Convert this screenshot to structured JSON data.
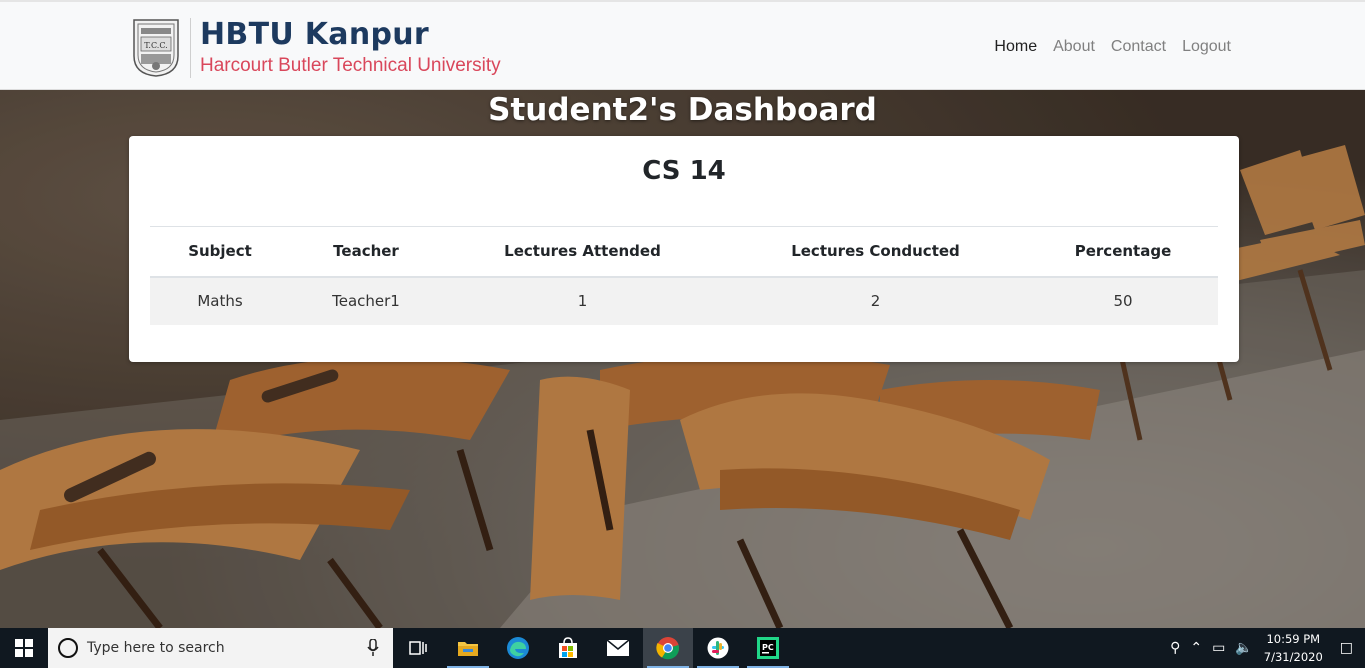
{
  "header": {
    "title": "HBTU Kanpur",
    "subtitle": "Harcourt Butler Technical  University",
    "nav": [
      {
        "label": "Home"
      },
      {
        "label": "About"
      },
      {
        "label": "Contact"
      },
      {
        "label": "Logout"
      }
    ]
  },
  "dashboard": {
    "title": "Student2's Dashboard",
    "class_name": "CS 14",
    "table": {
      "columns": [
        "Subject",
        "Teacher",
        "Lectures Attended",
        "Lectures Conducted",
        "Percentage"
      ],
      "rows": [
        [
          "Maths",
          "Teacher1",
          "1",
          "2",
          "50"
        ]
      ]
    }
  },
  "taskbar": {
    "search_placeholder": "Type here to search",
    "apps": [
      "task-view-icon",
      "file-explorer-icon",
      "edge-icon",
      "store-icon",
      "mail-icon",
      "chrome-icon",
      "slack-icon",
      "pycharm-icon"
    ],
    "time": "10:59 PM",
    "date": "7/31/2020"
  },
  "colors": {
    "brand_title": "#1d3a5f",
    "brand_sub": "#d9475b",
    "nav_active": "#222222",
    "nav_inactive": "#808080",
    "taskbar": "#101820"
  }
}
